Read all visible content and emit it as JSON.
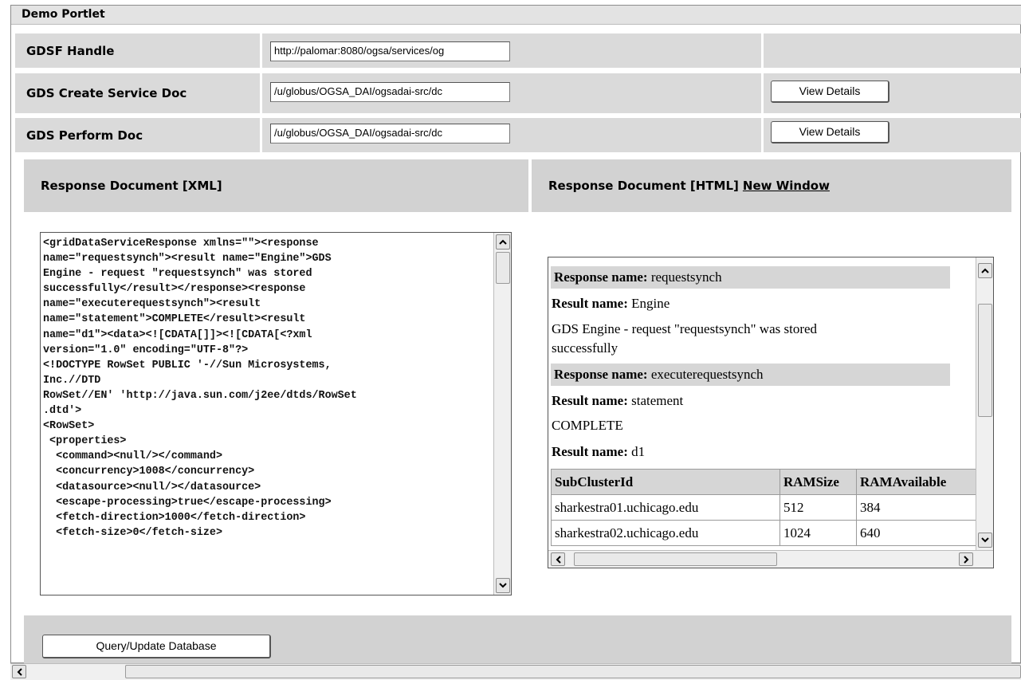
{
  "portlet": {
    "title": "Demo Portlet"
  },
  "config_rows": [
    {
      "label": "GDSF Handle",
      "value": "http://palomar:8080/ogsa/services/og",
      "button": ""
    },
    {
      "label": "GDS Create Service Doc",
      "value": "/u/globus/OGSA_DAI/ogsadai-src/dc",
      "button": "View Details"
    },
    {
      "label": "GDS Perform Doc",
      "value": "/u/globus/OGSA_DAI/ogsadai-src/dc",
      "button": "View Details"
    }
  ],
  "xml_pane": {
    "heading": "Response Document [XML]",
    "lines": [
      "<gridDataServiceResponse xmlns=\"\"><response",
      "name=\"requestsynch\"><result name=\"Engine\">GDS",
      "Engine - request \"requestsynch\" was stored",
      "successfully</result></response><response",
      "name=\"executerequestsynch\"><result",
      "name=\"statement\">COMPLETE</result><result",
      "name=\"d1\"><data><![CDATA[]]><![CDATA[<?xml",
      "version=\"1.0\" encoding=\"UTF-8\"?>",
      "<!DOCTYPE RowSet PUBLIC '-//Sun Microsystems,",
      "Inc.//DTD",
      "RowSet//EN' 'http://java.sun.com/j2ee/dtds/RowSet",
      ".dtd'>",
      "<RowSet>",
      " <properties>",
      "  <command><null/></command>",
      "  <concurrency>1008</concurrency>",
      "  <datasource><null/></datasource>",
      "  <escape-processing>true</escape-processing>",
      "  <fetch-direction>1000</fetch-direction>",
      "  <fetch-size>0</fetch-size>"
    ]
  },
  "html_pane": {
    "heading": "Response Document [HTML]",
    "link": "New Window",
    "response1": {
      "label": "Response name:",
      "value": "requestsynch"
    },
    "result1": {
      "label": "Result name:",
      "value": "Engine"
    },
    "msg_line1": "GDS Engine - request \"requestsynch\" was stored",
    "msg_line2": "successfully",
    "response2": {
      "label": "Response name:",
      "value": "executerequestsynch"
    },
    "result2": {
      "label": "Result name:",
      "value": "statement"
    },
    "status": "COMPLETE",
    "result3": {
      "label": "Result name:",
      "value": "d1"
    },
    "table": {
      "headers": [
        "SubClusterId",
        "RAMSize",
        "RAMAvailable"
      ],
      "rows": [
        [
          "sharkestra01.uchicago.edu",
          "512",
          "384"
        ],
        [
          "sharkestra02.uchicago.edu",
          "1024",
          "640"
        ]
      ]
    }
  },
  "footer": {
    "query_button": "Query/Update Database"
  }
}
